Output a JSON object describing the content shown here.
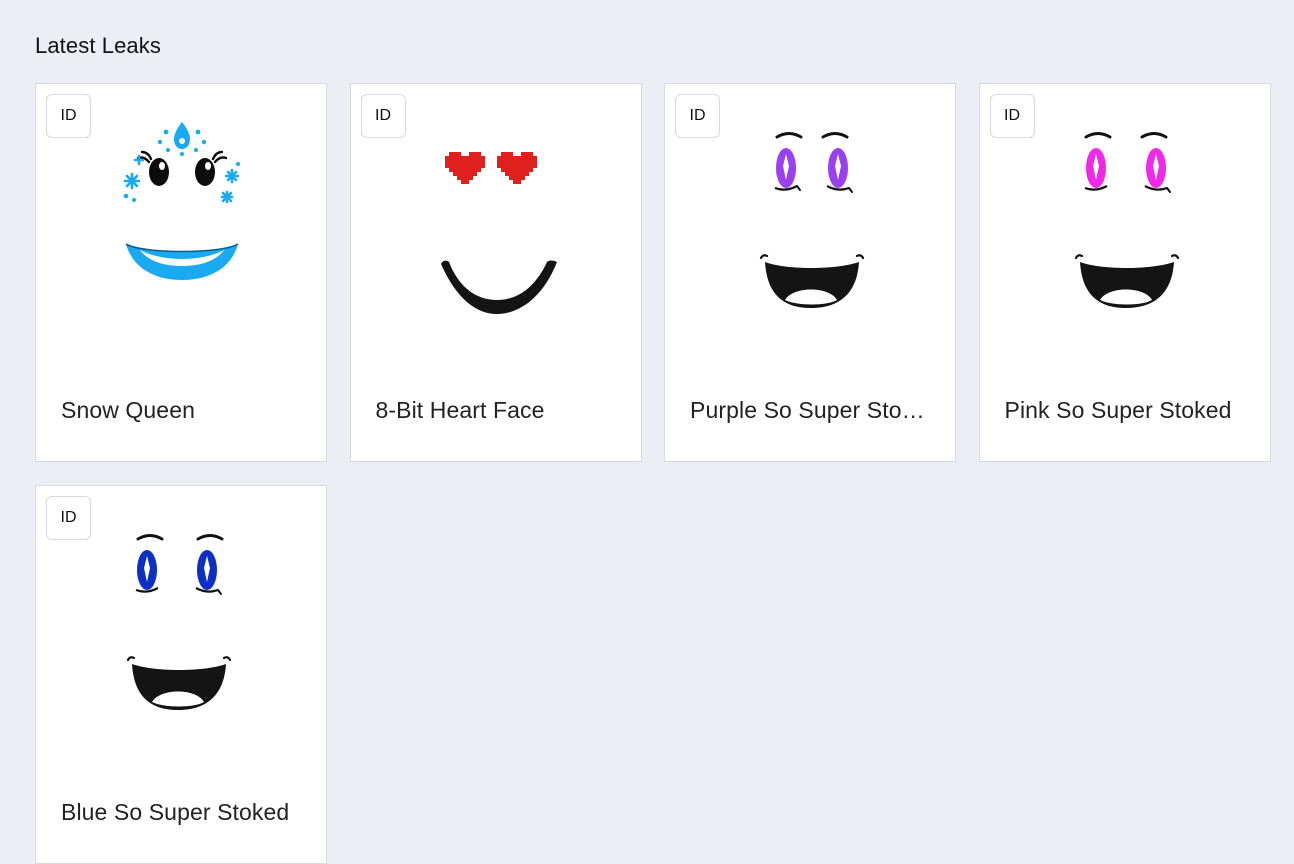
{
  "section": {
    "title": "Latest Leaks"
  },
  "cards": [
    {
      "badge": "ID",
      "name": "Snow Queen",
      "face_icon": "snow-queen-face-icon",
      "accent": "#1aaaf2"
    },
    {
      "badge": "ID",
      "name": "8-Bit Heart Face",
      "face_icon": "heart-face-icon",
      "accent": "#e0201c"
    },
    {
      "badge": "ID",
      "name": "Purple So Super Stoked",
      "face_icon": "super-stoked-face-icon",
      "accent": "#9b40f0"
    },
    {
      "badge": "ID",
      "name": "Pink So Super Stoked",
      "face_icon": "super-stoked-face-icon",
      "accent": "#f028e8"
    },
    {
      "badge": "ID",
      "name": "Blue So Super Stoked",
      "face_icon": "super-stoked-face-icon",
      "accent": "#0d2fc4"
    }
  ]
}
